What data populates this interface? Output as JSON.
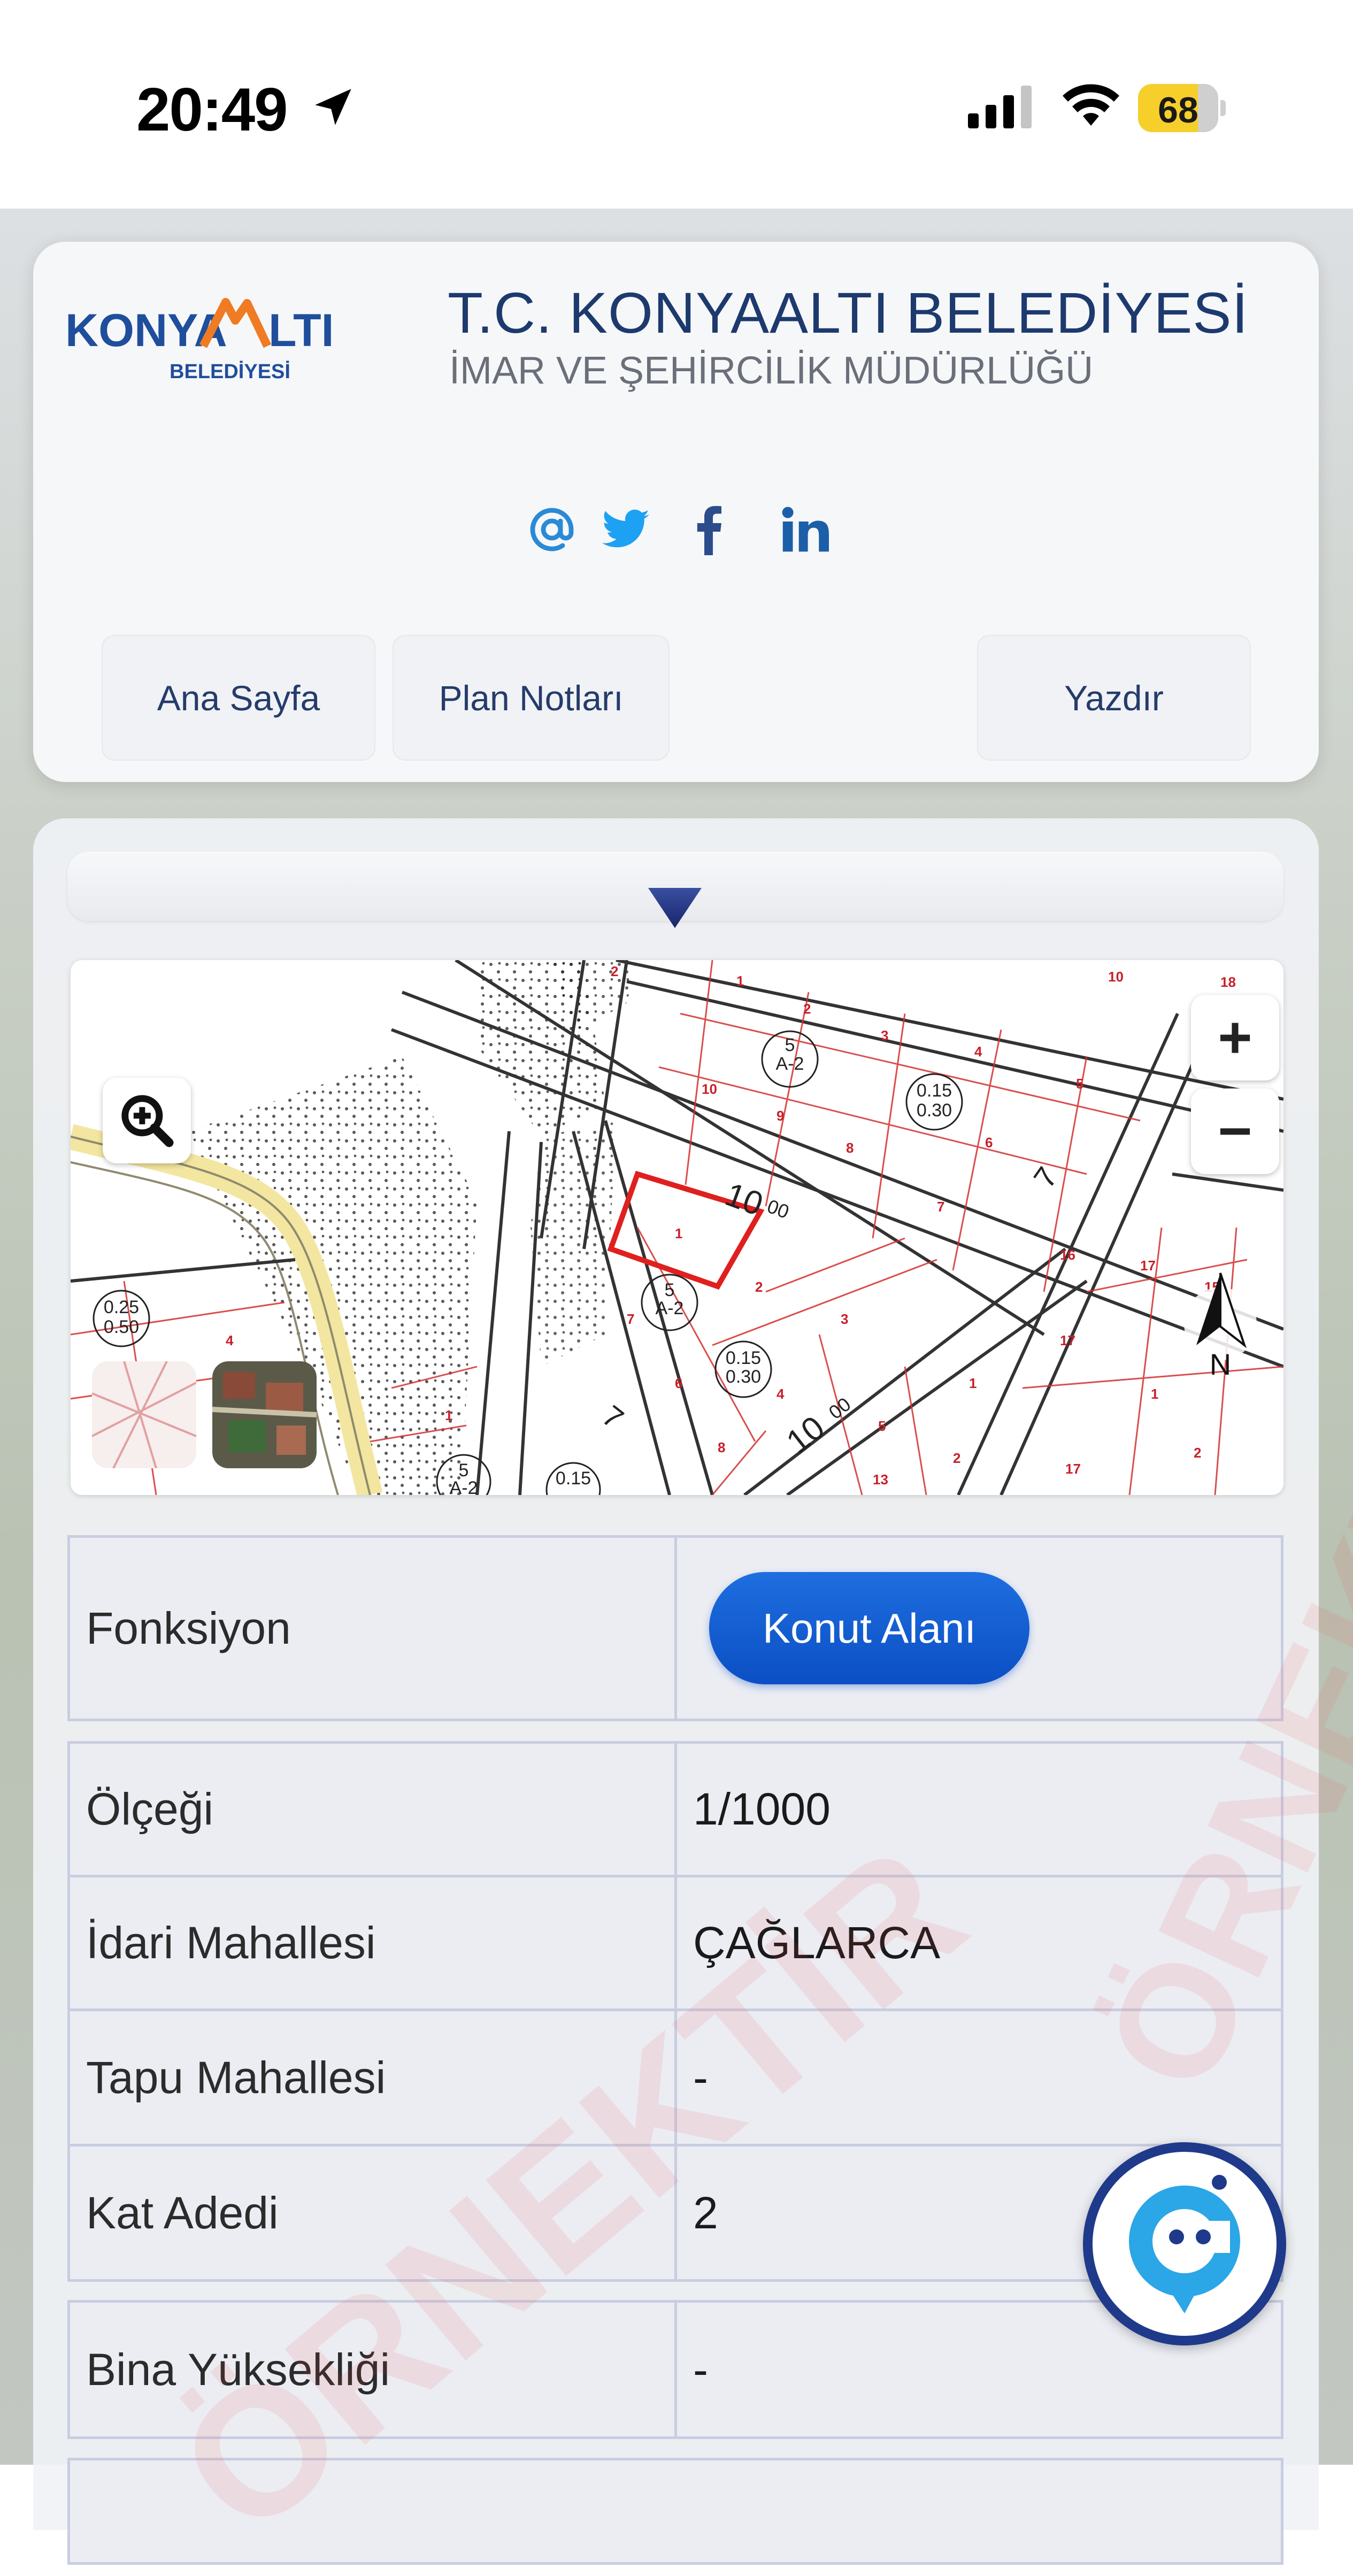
{
  "status_bar": {
    "time": "20:49",
    "battery": "68"
  },
  "header": {
    "logo_text": "KONYAALTI",
    "logo_sub": "BELEDİYESİ",
    "title": "T.C. KONYAALTI BELEDİYESİ",
    "subtitle": "İMAR VE ŞEHİRCİLİK MÜDÜRLÜĞÜ",
    "social": [
      "at-icon",
      "twitter-icon",
      "facebook-icon",
      "linkedin-icon"
    ],
    "nav": {
      "home": "Ana Sayfa",
      "notes": "Plan Notları",
      "print": "Yazdır"
    }
  },
  "map": {
    "zoom_in": "+",
    "zoom_out": "−",
    "compass_label": "N",
    "labels": [
      "10",
      "00",
      "7",
      "10",
      "0.15",
      "0.30",
      "0.25",
      "0.50",
      "A-2",
      "5",
      "3"
    ]
  },
  "info": {
    "function_label": "Fonksiyon",
    "function_value": "Konut Alanı",
    "rows": [
      {
        "label": "Ölçeği",
        "value": "1/1000"
      },
      {
        "label": "İdari Mahallesi",
        "value": "ÇAĞLARCA"
      },
      {
        "label": "Tapu Mahallesi",
        "value": "-"
      },
      {
        "label": "Kat Adedi",
        "value": "2"
      },
      {
        "label": "Bina Yüksekliği",
        "value": "-"
      }
    ]
  },
  "watermark": "ÖRNEKTİR",
  "colors": {
    "primary": "#1d3a6e",
    "accent": "#0b4fc4",
    "border": "#c9cde0"
  }
}
